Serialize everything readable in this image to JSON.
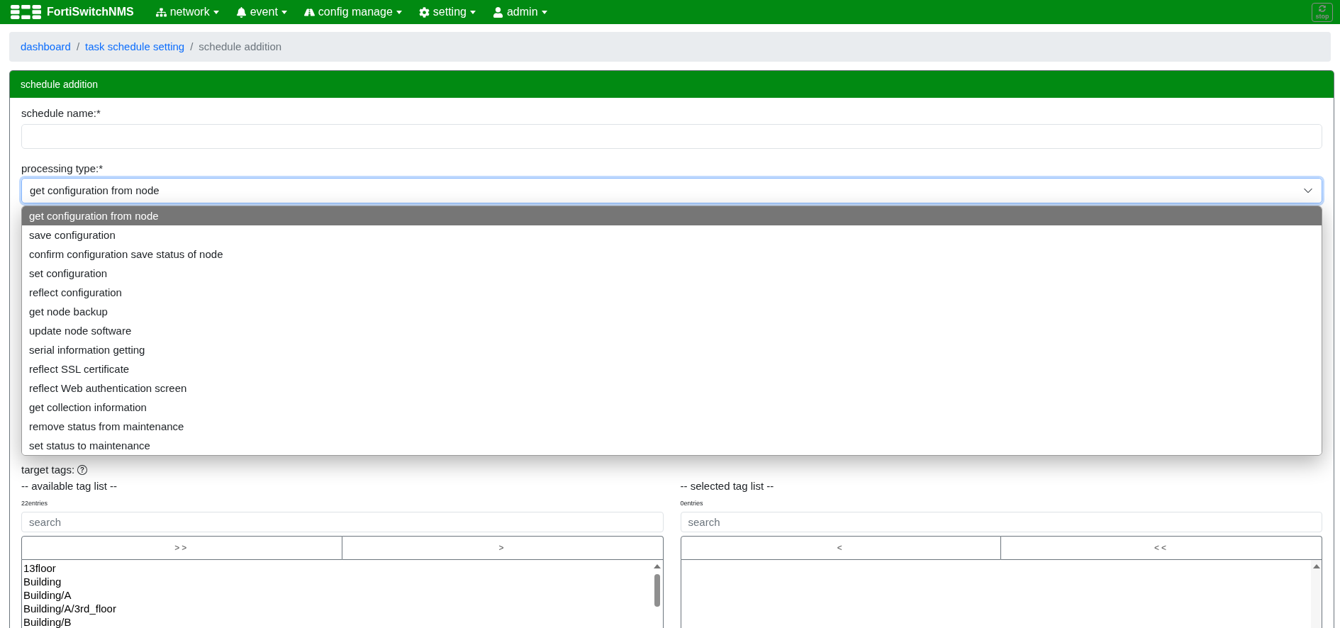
{
  "navbar": {
    "brand": "FortiSwitchNMS",
    "menus": [
      {
        "label": "network"
      },
      {
        "label": "event"
      },
      {
        "label": "config manage"
      },
      {
        "label": "setting"
      },
      {
        "label": "admin"
      }
    ],
    "stop_button": {
      "label": "stop",
      "disabled": true
    }
  },
  "breadcrumb": [
    {
      "label": "dashboard",
      "kind": "link"
    },
    {
      "label": "/",
      "kind": "separator"
    },
    {
      "label": "task schedule setting",
      "kind": "link"
    },
    {
      "label": "/",
      "kind": "separator"
    },
    {
      "label": "schedule addition",
      "kind": "current"
    }
  ],
  "card": {
    "title": "schedule addition",
    "schedule_name": {
      "label": "schedule name:*"
    },
    "processing_type": {
      "label": "processing type:*",
      "value": "get configuration from node",
      "expanded": true,
      "options": [
        {
          "label": "get configuration from node",
          "selected": true
        },
        {
          "label": "save configuration",
          "selected": false
        },
        {
          "label": "confirm configuration save status of node",
          "selected": false
        },
        {
          "label": "set configuration",
          "selected": false
        },
        {
          "label": "reflect configuration",
          "selected": false
        },
        {
          "label": "get node backup",
          "selected": false
        },
        {
          "label": "update node software",
          "selected": false
        },
        {
          "label": "serial information getting",
          "selected": false
        },
        {
          "label": "reflect SSL certificate",
          "selected": false
        },
        {
          "label": "reflect Web authentication screen",
          "selected": false
        },
        {
          "label": "get collection information",
          "selected": false
        },
        {
          "label": "remove status from maintenance",
          "selected": false
        },
        {
          "label": "set status to maintenance",
          "selected": false
        }
      ]
    },
    "target_tags": {
      "label": "target tags:",
      "available_list": {
        "title": "-- available tag list --",
        "count": "22entries",
        "search": {
          "placeholder": "search"
        },
        "buttons": [
          ">>",
          ">"
        ],
        "items": [
          {
            "label": "13floor",
            "selected": false
          },
          {
            "label": "Building",
            "selected": false
          },
          {
            "label": "Building/A",
            "selected": false
          },
          {
            "label": "Building/A/3rd_floor",
            "selected": false
          },
          {
            "label": "Building/B",
            "selected": false
          }
        ]
      },
      "selected_list": {
        "title": "-- selected tag list --",
        "count": "0entries",
        "search": {
          "placeholder": "search"
        },
        "buttons": [
          "<",
          "<<"
        ]
      }
    }
  }
}
